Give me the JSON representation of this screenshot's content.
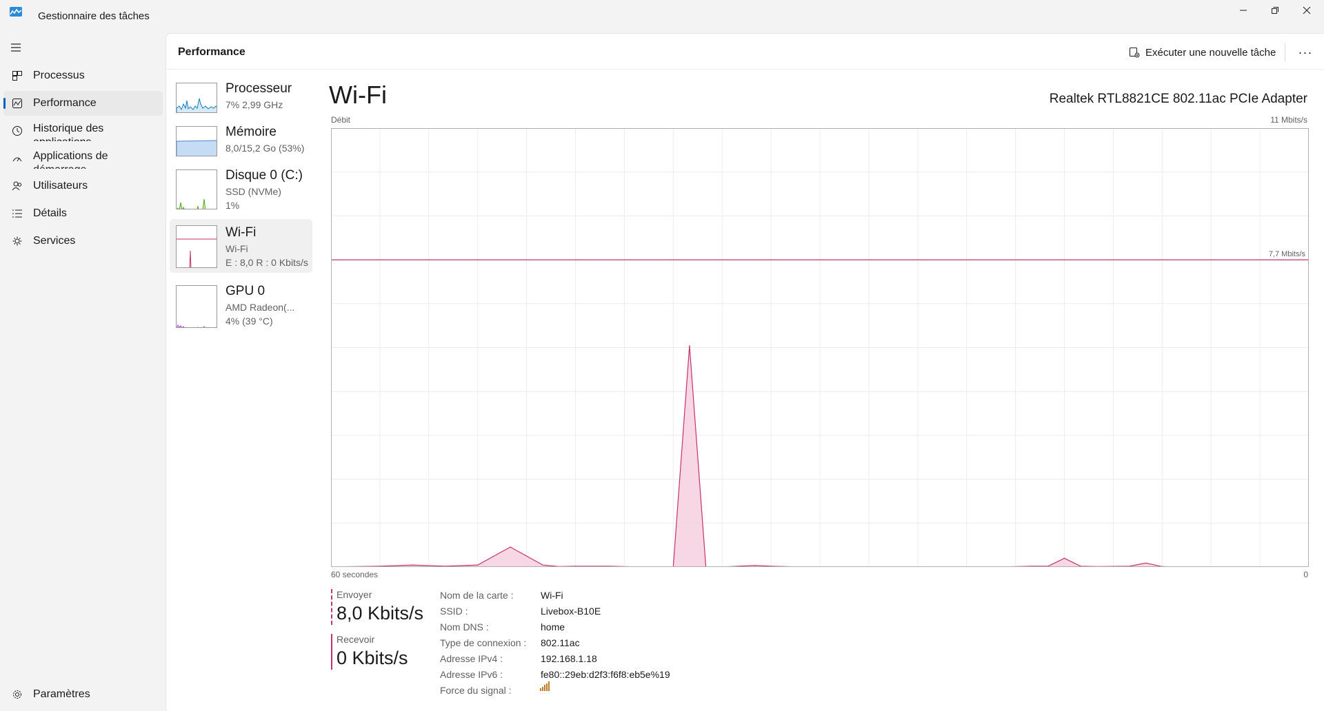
{
  "window": {
    "title": "Gestionnaire des tâches"
  },
  "nav": {
    "items": [
      {
        "label": "Processus",
        "icon": "processes-icon"
      },
      {
        "label": "Performance",
        "icon": "performance-icon",
        "active": true
      },
      {
        "label": "Historique des applications",
        "icon": "history-icon"
      },
      {
        "label": "Applications de démarrage",
        "icon": "startup-icon"
      },
      {
        "label": "Utilisateurs",
        "icon": "users-icon"
      },
      {
        "label": "Détails",
        "icon": "details-icon"
      },
      {
        "label": "Services",
        "icon": "services-icon"
      }
    ],
    "settings": "Paramètres"
  },
  "header": {
    "title": "Performance",
    "run_task": "Exécuter une nouvelle tâche",
    "more": "···"
  },
  "resources": [
    {
      "name": "Processeur",
      "line1": "7% 2,99 GHz",
      "line2": ""
    },
    {
      "name": "Mémoire",
      "line1": "8,0/15,2 Go (53%)",
      "line2": ""
    },
    {
      "name": "Disque 0 (C:)",
      "line1": "SSD (NVMe)",
      "line2": "1%"
    },
    {
      "name": "Wi-Fi",
      "line1": "Wi-Fi",
      "line2": "E : 8,0 R : 0 Kbits/s",
      "active": true
    },
    {
      "name": "GPU 0",
      "line1": "AMD Radeon(...",
      "line2": "4% (39 °C)"
    }
  ],
  "detail": {
    "title": "Wi-Fi",
    "adapter": "Realtek RTL8821CE 802.11ac PCIe Adapter",
    "graph_label": "Débit",
    "graph_max": "11 Mbits/s",
    "graph_scale_line": "7,7 Mbits/s",
    "graph_time": "60 secondes",
    "graph_zero": "0",
    "send_label": "Envoyer",
    "send_value": "8,0 Kbits/s",
    "recv_label": "Recevoir",
    "recv_value": "0 Kbits/s",
    "properties": [
      {
        "key": "Nom de la carte :",
        "value": "Wi-Fi"
      },
      {
        "key": "SSID :",
        "value": "Livebox-B10E"
      },
      {
        "key": "Nom DNS :",
        "value": "home"
      },
      {
        "key": "Type de connexion :",
        "value": "802.11ac"
      },
      {
        "key": "Adresse IPv4 :",
        "value": "192.168.1.18"
      },
      {
        "key": "Adresse IPv6 :",
        "value": "fe80::29eb:d2f3:f6f8:eb5e%19"
      },
      {
        "key": "Force du signal :",
        "value": ""
      }
    ]
  },
  "colors": {
    "wifi": "#c4316b",
    "wifi_fill": "#f6d3e0",
    "cpu": "#117dbb",
    "memory": "#8b12ae",
    "disk": "#4da60c",
    "gpu": "#ac39ff",
    "accent": "#005fb8"
  },
  "chart_data": {
    "type": "area",
    "ylabel": "Débit",
    "ylim": [
      0,
      11
    ],
    "y_unit": "Mbits/s",
    "xlim": [
      60,
      0
    ],
    "x_unit": "secondes",
    "series": [
      {
        "x": [
          60,
          57,
          55,
          53,
          51,
          49,
          47,
          46,
          45,
          43,
          41,
          39,
          38,
          37,
          36,
          35,
          34,
          33,
          31,
          29,
          27,
          25,
          23,
          21,
          19,
          17,
          16,
          15,
          14,
          13,
          11,
          10,
          9,
          8,
          7,
          5,
          3,
          1,
          0
        ],
        "values": [
          0,
          0.02,
          0.05,
          0.02,
          0.05,
          0.5,
          0.05,
          0.01,
          0.02,
          0.02,
          0,
          0,
          5.55,
          0,
          0,
          0.02,
          0.04,
          0.02,
          0,
          0,
          0,
          0,
          0,
          0,
          0,
          0.02,
          0.02,
          0.22,
          0.02,
          0.01,
          0.02,
          0.1,
          0.01,
          0,
          0,
          0,
          0,
          0,
          0
        ]
      }
    ]
  }
}
